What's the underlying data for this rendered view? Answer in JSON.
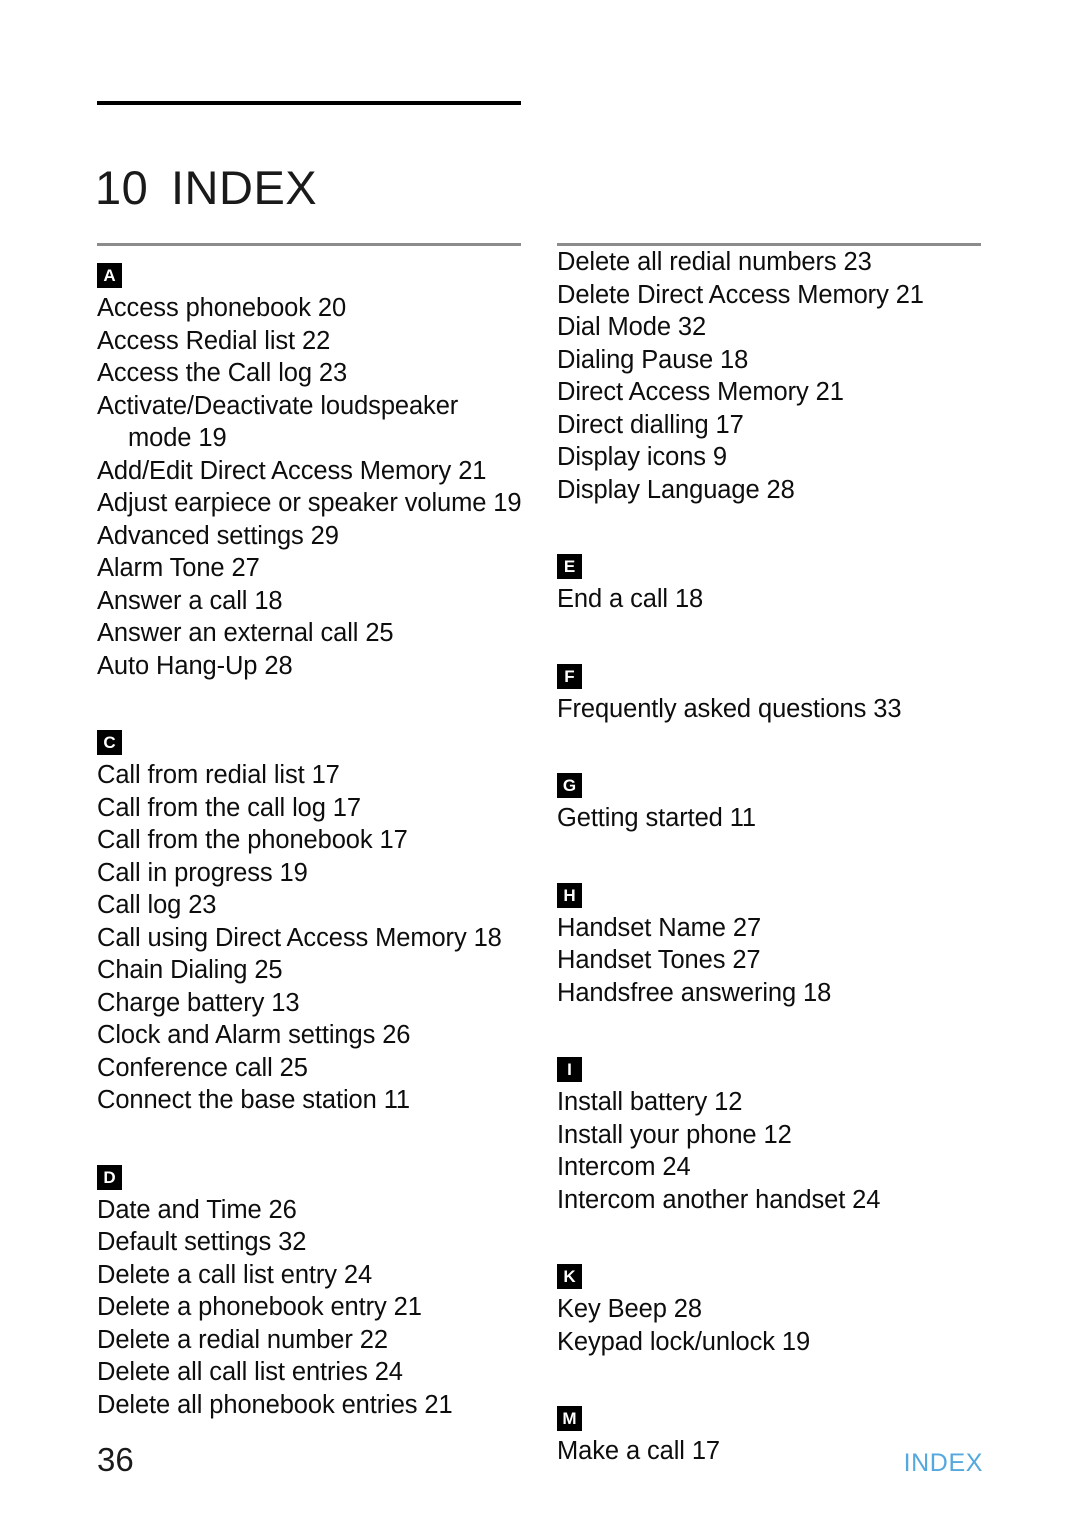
{
  "document": {
    "chapter_number": "10",
    "chapter_title": "INDEX"
  },
  "footer": {
    "page_number": "36",
    "label": "INDEX",
    "label_color": "#54a8dd"
  },
  "colors": {
    "text": "#0d0d0d",
    "badge_background": "#000000",
    "badge_text": "#ffffff",
    "header_rule": "#000000",
    "column_rule": "#8c8c8c",
    "footer_accent": "#54a8dd"
  },
  "columns": [
    {
      "name": "left-column",
      "sections": [
        {
          "letter": "A",
          "entries": [
            {
              "text": "Access phonebook 20",
              "indent": false
            },
            {
              "text": "Access Redial list 22",
              "indent": false
            },
            {
              "text": "Access the Call log 23",
              "indent": false
            },
            {
              "text": "Activate/Deactivate loudspeaker",
              "indent": false
            },
            {
              "text": "mode 19",
              "indent": true
            },
            {
              "text": "Add/Edit Direct Access Memory 21",
              "indent": false
            },
            {
              "text": "Adjust earpiece or speaker volume 19",
              "indent": false
            },
            {
              "text": "Advanced settings 29",
              "indent": false
            },
            {
              "text": "Alarm Tone 27",
              "indent": false
            },
            {
              "text": "Answer a call 18",
              "indent": false
            },
            {
              "text": "Answer an external call 25",
              "indent": false
            },
            {
              "text": "Auto Hang-Up 28",
              "indent": false
            }
          ]
        },
        {
          "letter": "C",
          "entries": [
            {
              "text": "Call from redial list 17",
              "indent": false
            },
            {
              "text": "Call from the call log 17",
              "indent": false
            },
            {
              "text": "Call from the phonebook 17",
              "indent": false
            },
            {
              "text": "Call in progress 19",
              "indent": false
            },
            {
              "text": "Call log 23",
              "indent": false
            },
            {
              "text": "Call using Direct Access Memory 18",
              "indent": false
            },
            {
              "text": "Chain Dialing 25",
              "indent": false
            },
            {
              "text": "Charge battery 13",
              "indent": false
            },
            {
              "text": "Clock and Alarm settings 26",
              "indent": false
            },
            {
              "text": "Conference call 25",
              "indent": false
            },
            {
              "text": "Connect the base station 11",
              "indent": false
            }
          ]
        },
        {
          "letter": "D",
          "entries": [
            {
              "text": "Date and Time 26",
              "indent": false
            },
            {
              "text": "Default settings 32",
              "indent": false
            },
            {
              "text": "Delete a call list entry 24",
              "indent": false
            },
            {
              "text": "Delete a phonebook entry 21",
              "indent": false
            },
            {
              "text": "Delete a redial number 22",
              "indent": false
            },
            {
              "text": "Delete all call list entries 24",
              "indent": false
            },
            {
              "text": "Delete all phonebook entries 21",
              "indent": false
            }
          ]
        }
      ]
    },
    {
      "name": "right-column",
      "sections": [
        {
          "letter": "",
          "entries": [
            {
              "text": "Delete all redial numbers 23",
              "indent": false
            },
            {
              "text": "Delete Direct Access Memory 21",
              "indent": false
            },
            {
              "text": "Dial Mode 32",
              "indent": false
            },
            {
              "text": "Dialing Pause 18",
              "indent": false
            },
            {
              "text": "Direct Access Memory 21",
              "indent": false
            },
            {
              "text": "Direct dialling 17",
              "indent": false
            },
            {
              "text": "Display icons 9",
              "indent": false
            },
            {
              "text": "Display Language 28",
              "indent": false
            }
          ]
        },
        {
          "letter": "E",
          "entries": [
            {
              "text": "End a call 18",
              "indent": false
            }
          ]
        },
        {
          "letter": "F",
          "entries": [
            {
              "text": "Frequently asked questions 33",
              "indent": false
            }
          ]
        },
        {
          "letter": "G",
          "entries": [
            {
              "text": "Getting started 11",
              "indent": false
            }
          ]
        },
        {
          "letter": "H",
          "entries": [
            {
              "text": "Handset Name 27",
              "indent": false
            },
            {
              "text": "Handset Tones 27",
              "indent": false
            },
            {
              "text": "Handsfree answering 18",
              "indent": false
            }
          ]
        },
        {
          "letter": "I",
          "entries": [
            {
              "text": "Install battery 12",
              "indent": false
            },
            {
              "text": "Install your phone 12",
              "indent": false
            },
            {
              "text": "Intercom 24",
              "indent": false
            },
            {
              "text": "Intercom another handset 24",
              "indent": false
            }
          ]
        },
        {
          "letter": "K",
          "entries": [
            {
              "text": "Key Beep 28",
              "indent": false
            },
            {
              "text": "Keypad lock/unlock 19",
              "indent": false
            }
          ]
        },
        {
          "letter": "M",
          "entries": [
            {
              "text": "Make a call 17",
              "indent": false
            }
          ]
        }
      ]
    }
  ]
}
